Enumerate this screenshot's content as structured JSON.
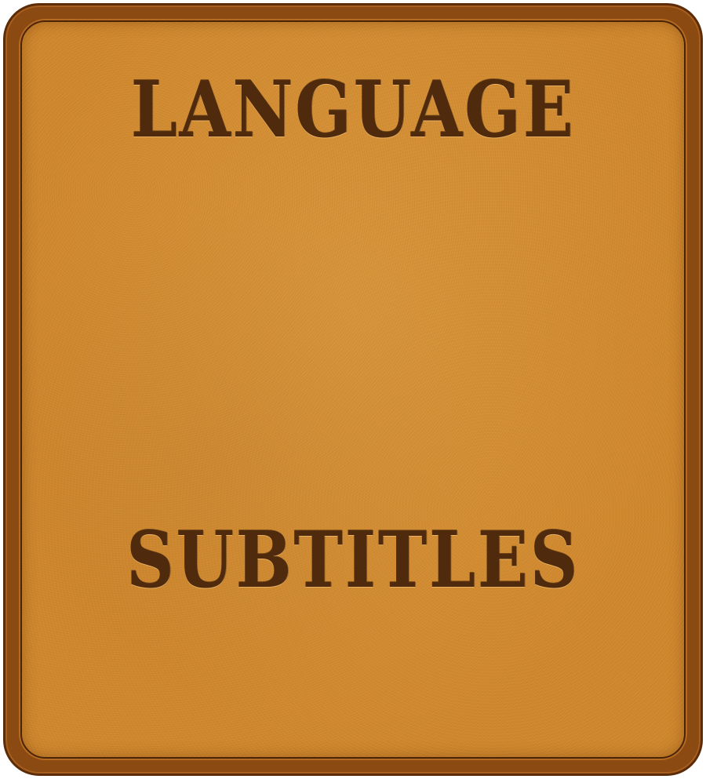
{
  "menu": {
    "items": [
      {
        "label": "LANGUAGE"
      },
      {
        "label": "SUBTITLES"
      }
    ]
  },
  "colors": {
    "panel_fill": "#d0882e",
    "panel_border": "#8a4a12",
    "text": "#4f2a0c"
  }
}
